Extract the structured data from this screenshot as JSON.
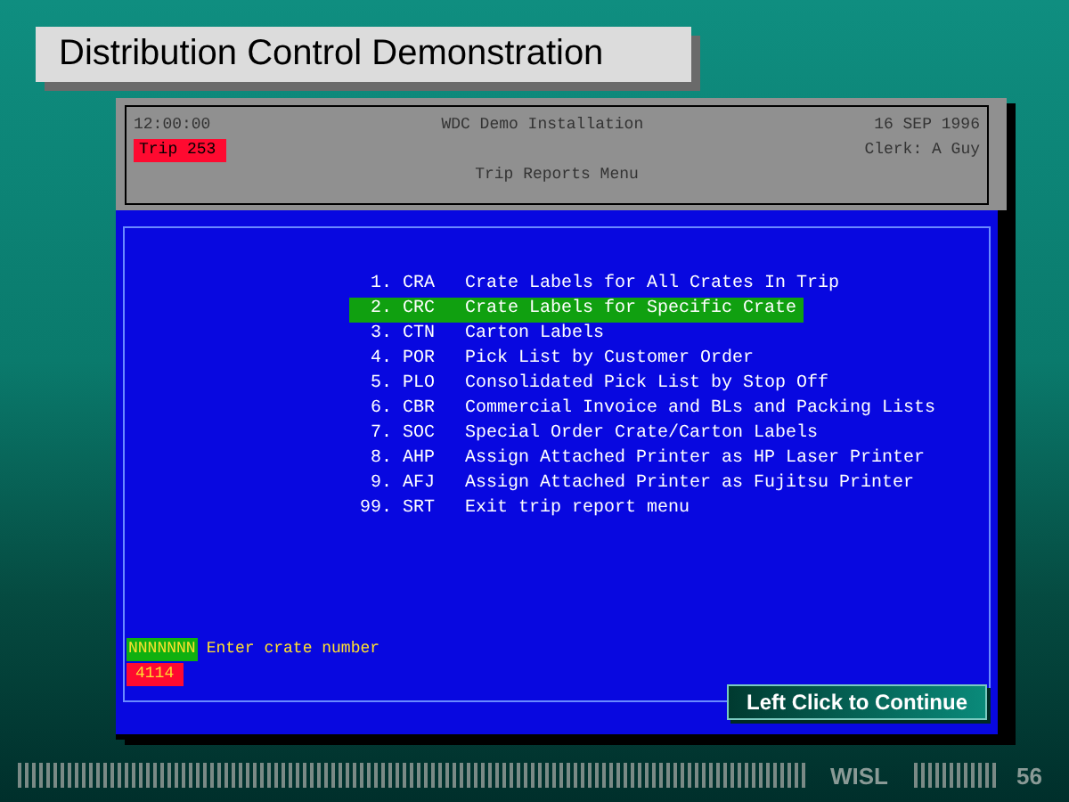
{
  "slide_title": "Distribution Control Demonstration",
  "terminal": {
    "header": {
      "time": "12:00:00",
      "system": "WDC Demo Installation",
      "date": "16 SEP 1996",
      "trip": "Trip 253",
      "clerk": "Clerk: A Guy",
      "menu_title": "Trip Reports Menu"
    },
    "menu": [
      {
        "number": "1.",
        "code": "CRA",
        "label": "Crate Labels for All Crates In Trip",
        "selected": false
      },
      {
        "number": "2.",
        "code": "CRC",
        "label": "Crate Labels for Specific Crate",
        "selected": true
      },
      {
        "number": "3.",
        "code": "CTN",
        "label": "Carton Labels",
        "selected": false
      },
      {
        "number": "4.",
        "code": "POR",
        "label": "Pick List by Customer Order",
        "selected": false
      },
      {
        "number": "5.",
        "code": "PLO",
        "label": "Consolidated Pick List by Stop Off",
        "selected": false
      },
      {
        "number": "6.",
        "code": "CBR",
        "label": "Commercial Invoice and BLs and Packing Lists",
        "selected": false
      },
      {
        "number": "7.",
        "code": "SOC",
        "label": "Special Order Crate/Carton Labels",
        "selected": false
      },
      {
        "number": "8.",
        "code": "AHP",
        "label": "Assign Attached Printer as HP Laser Printer",
        "selected": false
      },
      {
        "number": "9.",
        "code": "AFJ",
        "label": "Assign Attached Printer as Fujitsu Printer",
        "selected": false
      },
      {
        "number": "99.",
        "code": "SRT",
        "label": "Exit trip report menu",
        "selected": false
      }
    ],
    "prompt": {
      "mask": "NNNNNNN",
      "label": "Enter crate number",
      "value": "4114"
    }
  },
  "continue_button": "Left Click to Continue",
  "footer": {
    "org": "WISL",
    "page": "56"
  }
}
